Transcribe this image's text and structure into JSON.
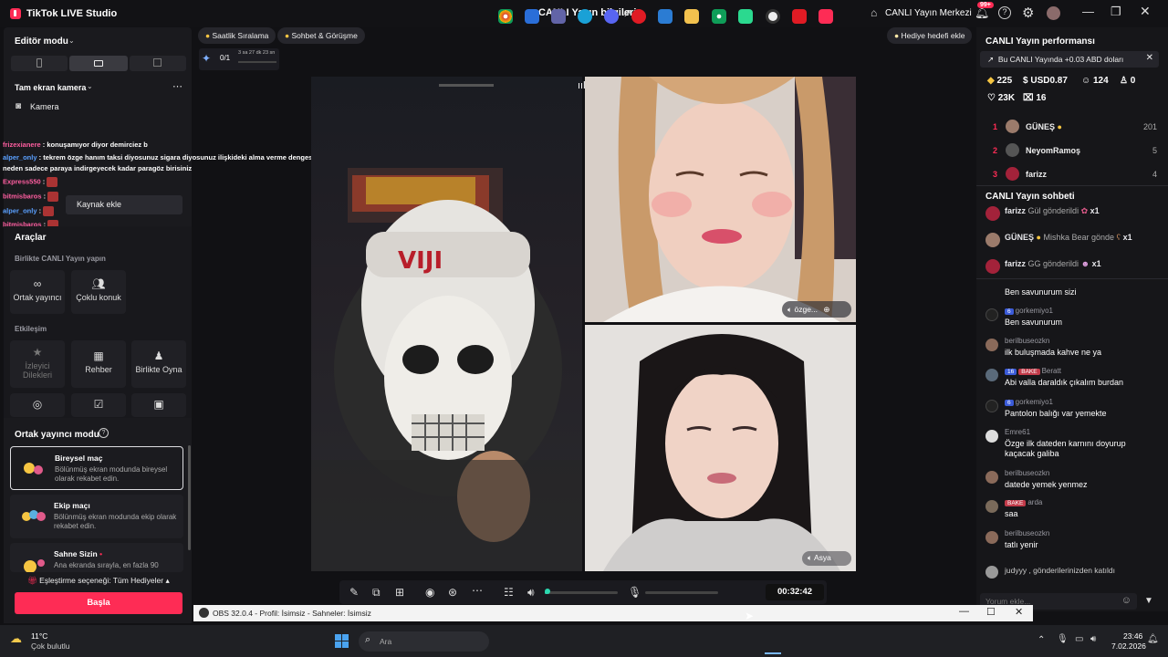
{
  "app": {
    "title": "TikTok LIVE Studio",
    "center_title": "CANLI Yayın bilgileri",
    "live_center": "CANLI Yayın Merkezi",
    "notif_badge": "99+"
  },
  "left": {
    "editor_mode": "Editör modu",
    "camera_section": "Tam ekran kamera",
    "camera_item": "Kamera",
    "add_source": "Kaynak ekle",
    "chat_overlay": [
      {
        "user": "frizexianere",
        "text": ": konuşamıyor diyor demirciez b"
      },
      {
        "user": "alper_only",
        "text": ": tekrem özge hanım taksi diyosunuz sigara diyosunuz ilişkideki alma verme dengesini"
      },
      {
        "user": "",
        "text": "neden sadece paraya indirgeyecek kadar paragöz birisiniz"
      },
      {
        "user": "Express550",
        "text": ":"
      },
      {
        "user": "bitmisbaros",
        "text": ":"
      },
      {
        "user": "alper_only",
        "text": ":"
      },
      {
        "user": "bitmisbaros",
        "text": ":"
      }
    ],
    "tools_title": "Araçlar",
    "collab_title": "Birlikte CANLI Yayın yapın",
    "tool_cohost": "Ortak yayıncı",
    "tool_multiguest": "Çoklu konuk",
    "interaction_title": "Etkileşim",
    "tool_viewer_wishes": "İzleyici Dilekleri",
    "tool_guide": "Rehber",
    "tool_play": "Birlikte Oyna",
    "cohost_mode_title": "Ortak yayıncı modu",
    "modes": [
      {
        "title": "Bireysel maç",
        "desc": "Bölünmüş ekran modunda bireysel olarak rekabet edin."
      },
      {
        "title": "Ekip maçı",
        "desc": "Bölünmüş ekran modunda ekip olarak rekabet edin."
      },
      {
        "title": "Sahne Sizin",
        "desc": "Ana ekranda sırayla, en fazla 90"
      }
    ],
    "match_option": "Eşleştirme seçeneği: Tüm Hediyeler",
    "start_button": "Başla"
  },
  "center": {
    "pill_hourly": "Saatlik Sıralama",
    "pill_chat": "Sohbet & Görüşme",
    "pill_gift_goal": "Hediye hedefi ekle",
    "goal_progress": "0/1",
    "goal_timer": "3 sa 27 dk 23 sn",
    "guest1_name": "özge...",
    "guest2_name": "Asya",
    "timer": "00:32:42",
    "volume_level": 0.04
  },
  "right": {
    "perf_title": "CANLI Yayın performansı",
    "earnings_banner": "Bu CANLI Yayında +0.03 ABD doları",
    "stats": {
      "coins": "225",
      "usd": "USD0.87",
      "viewers": "124",
      "new": "0",
      "likes": "23K",
      "gifts": "16"
    },
    "ranking": [
      {
        "rank": "1",
        "name": "GÜNEŞ",
        "score": "201"
      },
      {
        "rank": "2",
        "name": "NeyomRamoş",
        "score": "5"
      },
      {
        "rank": "3",
        "name": "farizz",
        "score": "4"
      }
    ],
    "chat_title": "CANLI Yayın sohbeti",
    "gift_msgs": [
      {
        "user": "farizz",
        "text": "Gül gönderildi",
        "count": "x1"
      },
      {
        "user": "GÜNEŞ",
        "text": "Mishka Bear gönde",
        "count": "x1"
      },
      {
        "user": "farizz",
        "text": "GG gönderildi",
        "count": "x1"
      }
    ],
    "chat_top_partial": "Ben savunurum sizi",
    "messages": [
      {
        "badge": "6",
        "user": "gorkemiyo1",
        "text": "Ben savunurum"
      },
      {
        "badge": "",
        "user": "berilbuseozkn",
        "text": "ilk buluşmada kahve ne ya"
      },
      {
        "badge": "16",
        "badge2": "BAKE",
        "user": "Beratt",
        "text": "Abi valla daraldık çıkalım burdan"
      },
      {
        "badge": "6",
        "user": "gorkemiyo1",
        "text": "Pantolon balığı var yemekte"
      },
      {
        "badge": "",
        "user": "Emre61",
        "text": "Özge ilk dateden karnını doyurup kaçacak galiba"
      },
      {
        "badge": "",
        "user": "berilbuseozkn",
        "text": "datede yemek yenmez"
      },
      {
        "badge": "",
        "badge2": "BAKE",
        "user": "arda",
        "text": "saa"
      },
      {
        "badge": "",
        "user": "berilbuseozkn",
        "text": "tatlı yenir"
      }
    ],
    "joined_msg": "judyyy , gönderilerinizden katıldı",
    "comment_placeholder": "Yorum ekle..."
  },
  "obs": {
    "title": "OBS 32.0.4 - Profil: İsimsiz - Sahneler: İsimsiz"
  },
  "taskbar": {
    "temp": "11°C",
    "weather": "Çok bulutlu",
    "search": "Ara",
    "time": "23:46",
    "date": "7.02.2026"
  }
}
